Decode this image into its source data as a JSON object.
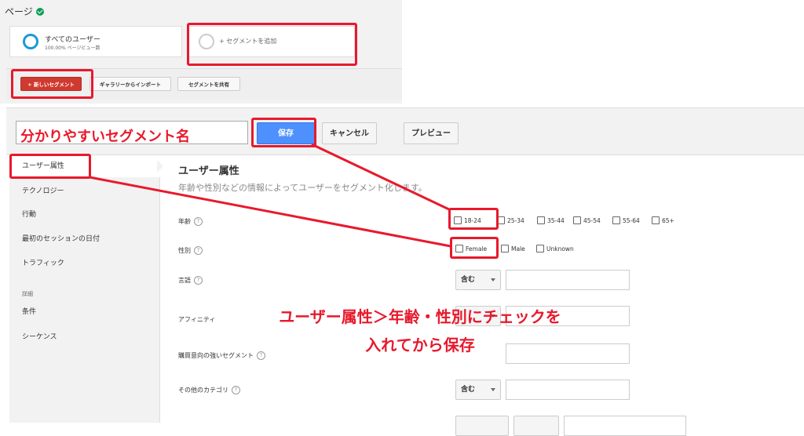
{
  "header": {
    "page_title": "ページ"
  },
  "segments": [
    {
      "name": "すべてのユーザー",
      "sub": "100.00% ページビュー数"
    },
    {
      "name": "+ セグメントを追加",
      "sub": ""
    }
  ],
  "toolbar_top": {
    "new_segment": "+ 新しいセグメント",
    "import_gallery": "ギャラリーからインポート",
    "share_segment": "セグメントを共有"
  },
  "editor": {
    "segment_name": "分かりやすいセグメント名",
    "save": "保存",
    "cancel": "キャンセル",
    "preview": "プレビュー"
  },
  "sidebar": {
    "items": [
      "ユーザー属性",
      "テクノロジー",
      "行動",
      "最初のセッションの日付",
      "トラフィック"
    ],
    "section_label": "詳細",
    "advanced_items": [
      "条件",
      "シーケンス"
    ]
  },
  "panel": {
    "title": "ユーザー属性",
    "description": "年齢や性別などの情報によってユーザーをセグメント化します。",
    "rows": {
      "age": "年齢",
      "gender": "性別",
      "language": "言語",
      "affinity": "アフィニティ",
      "in_market": "購買意向の強いセグメント",
      "other": "その他のカテゴリ"
    },
    "help": "?",
    "age_options": [
      "18-24",
      "25-34",
      "35-44",
      "45-54",
      "55-64",
      "65+"
    ],
    "gender_options": [
      "Female",
      "Male",
      "Unknown"
    ],
    "match_label": "含む"
  },
  "annotations": {
    "instruction_line1": "ユーザー属性＞年齢・性別にチェックを",
    "instruction_line2": "入れてから保存",
    "color": "#e8192c"
  },
  "colors": {
    "save_blue": "#4d90fe",
    "new_segment_red": "#d0392f",
    "ring_blue": "#1a9ad6"
  }
}
